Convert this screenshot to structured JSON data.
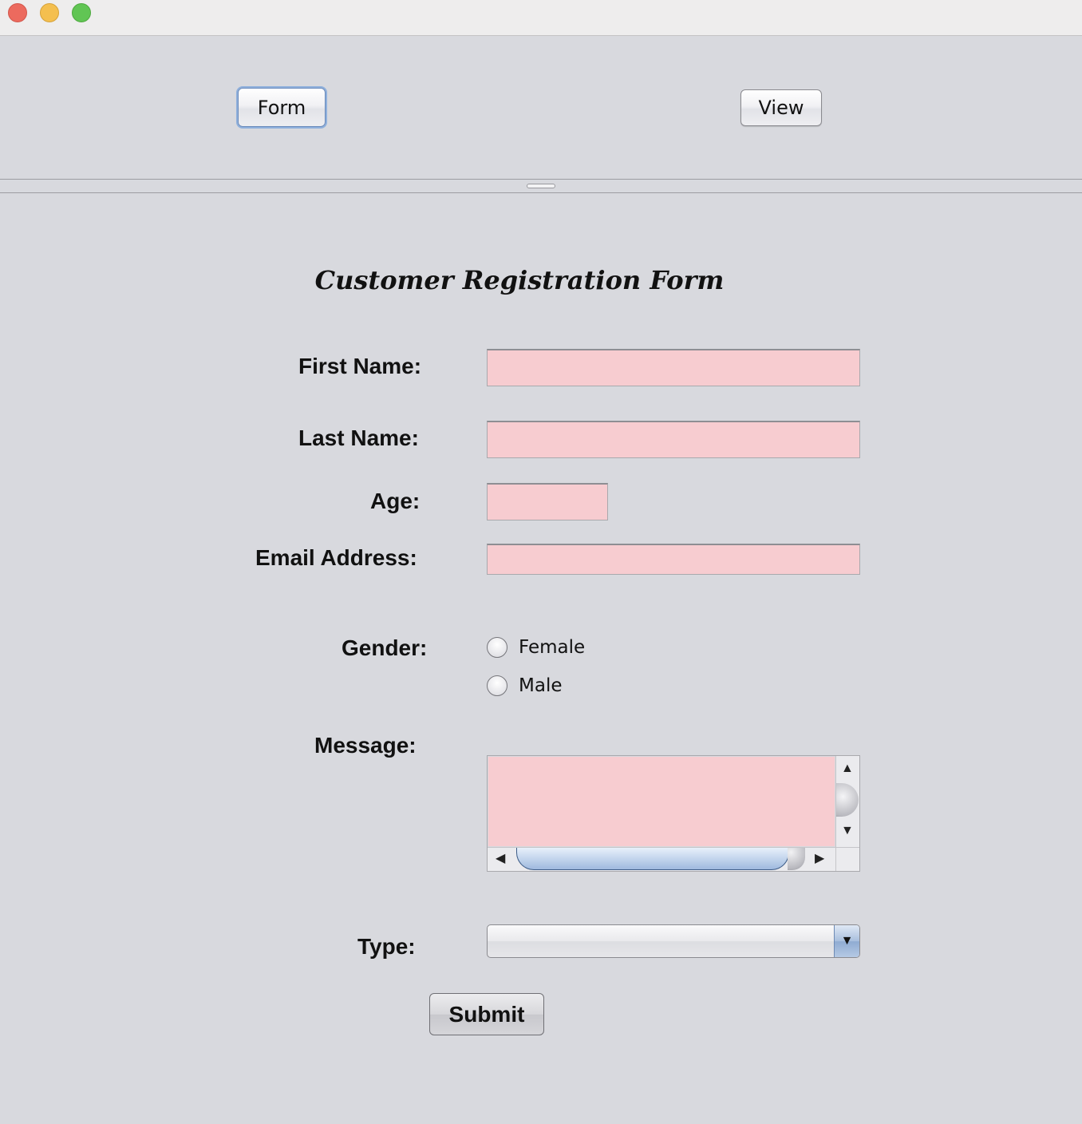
{
  "window": {
    "controls": [
      "close",
      "minimize",
      "maximize"
    ]
  },
  "toolbar": {
    "form_label": "Form",
    "view_label": "View",
    "focused": "Form"
  },
  "form": {
    "title": "Customer Registration Form",
    "first_name": {
      "label": "First Name:",
      "value": ""
    },
    "last_name": {
      "label": "Last Name:",
      "value": ""
    },
    "age": {
      "label": "Age:",
      "value": ""
    },
    "email": {
      "label": "Email Address:",
      "value": ""
    },
    "gender": {
      "label": "Gender:",
      "options": [
        "Female",
        "Male"
      ],
      "selected": null
    },
    "message": {
      "label": "Message:",
      "value": ""
    },
    "type": {
      "label": "Type:",
      "selected": ""
    },
    "submit_label": "Submit"
  },
  "colors": {
    "window_bg": "#d8d9de",
    "field_bg": "#f7ccd0",
    "titlebar_bg": "#eeeded",
    "close": "#ec6a5e",
    "minimize": "#f4bf4f",
    "maximize": "#61c554",
    "focus_ring": "#8fb0dc"
  }
}
